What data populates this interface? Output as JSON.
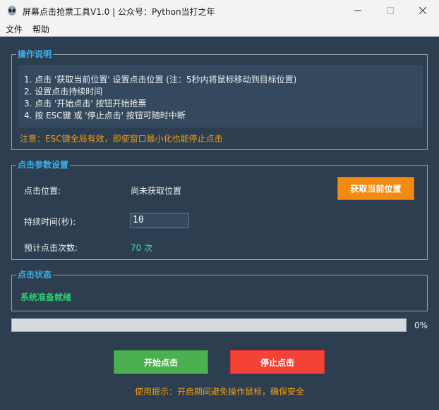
{
  "window": {
    "title": "屏幕点击抢票工具V1.0 | 公众号：Python当打之年",
    "menu": [
      "文件",
      "帮助"
    ]
  },
  "instructions": {
    "legend": "操作说明",
    "lines": [
      "1. 点击 '获取当前位置' 设置点击位置 (注：5秒内将鼠标移动到目标位置)",
      "2. 设置点击持续时间",
      "3. 点击 '开始点击' 按钮开始抢票",
      "4. 按 ESC键 或 '停止点击' 按钮可随时中断"
    ],
    "note": "注意：ESC键全局有效，即使窗口最小化也能停止点击"
  },
  "params": {
    "legend": "点击参数设置",
    "position_label": "点击位置:",
    "position_value": "尚未获取位置",
    "get_position_button": "获取当前位置",
    "duration_label": "持续时间(秒):",
    "duration_value": "10",
    "estimate_label": "预计点击次数:",
    "estimate_value": "70 次"
  },
  "status": {
    "legend": "点击状态",
    "text": "系统准备就绪"
  },
  "progress": {
    "value": 0,
    "label": "0%"
  },
  "buttons": {
    "start": "开始点击",
    "stop": "停止点击"
  },
  "tip": "使用提示：开启期间避免操作鼠标，确保安全",
  "colors": {
    "background": "#2c3e50",
    "accent": "#3bb0e8",
    "warning": "#f39c12",
    "success": "#2ecc71",
    "start": "#4caf50",
    "stop": "#f44336",
    "get_position": "#f58a11"
  }
}
